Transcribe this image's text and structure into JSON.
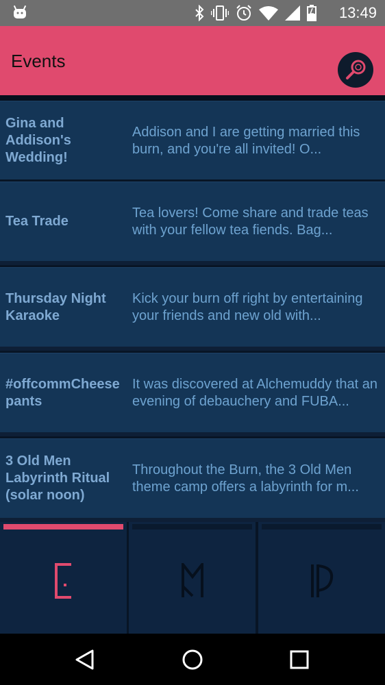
{
  "status_bar": {
    "time": "13:49",
    "icons": [
      "android-icon",
      "bluetooth-icon",
      "vibrate-icon",
      "alarm-icon",
      "wifi-icon",
      "signal-icon",
      "battery-charging-icon"
    ]
  },
  "app_bar": {
    "title": "Events",
    "background": "#e04a6e"
  },
  "events": [
    {
      "name": "Gina and Addison's Wedding!",
      "description": "Addison and I are getting married this burn, and you're all invited! O..."
    },
    {
      "name": "Tea Trade",
      "description": "Tea lovers! Come share and trade teas with your fellow tea fiends. Bag..."
    },
    {
      "name": "Thursday Night Karaoke",
      "description": "Kick your burn off right by entertaining your friends and new old with..."
    },
    {
      "name": "#offcommCheese pants",
      "description": "It was discovered at Alchemuddy that an evening of debauchery and FUBA..."
    },
    {
      "name": "3 Old Men Labyrinth Ritual (solar noon)",
      "description": "Throughout the Burn, the 3 Old Men theme camp offers a labyrinth for m..."
    }
  ],
  "tabs": [
    {
      "icon": "events-rune-icon",
      "selected": true
    },
    {
      "icon": "map-rune-icon",
      "selected": false
    },
    {
      "icon": "people-rune-icon",
      "selected": false
    }
  ],
  "colors": {
    "accent": "#e04a6e",
    "row_bg": "#143556",
    "name_text": "#7fa9d2",
    "desc_text": "#6ea3d0"
  },
  "nav_bar": [
    "back-icon",
    "home-icon",
    "recents-icon"
  ]
}
